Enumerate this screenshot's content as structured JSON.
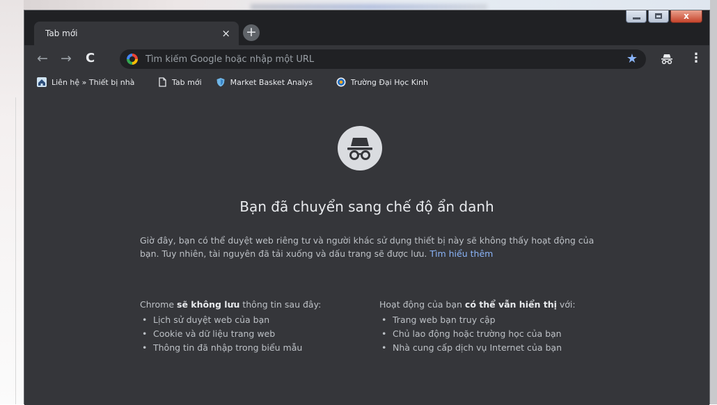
{
  "tab": {
    "title": "Tab mới",
    "close": "×",
    "new_tab": "+"
  },
  "window_controls": {
    "close": "x"
  },
  "toolbar": {
    "back": "←",
    "forward": "→",
    "reload": "C",
    "omnibox_placeholder": "Tìm kiếm Google hoặc nhập một URL",
    "star": "★",
    "menu": "⋮"
  },
  "bookmarks": [
    {
      "label": "Liên hệ » Thiết bị nhà",
      "icon": "home-icon"
    },
    {
      "label": "Tab mới",
      "icon": "page-icon"
    },
    {
      "label": "Market Basket Analys",
      "icon": "shield-icon"
    },
    {
      "label": "Trường Đại Học Kinh",
      "icon": "university-icon"
    }
  ],
  "content": {
    "headline": "Bạn đã chuyển sang chế độ ẩn danh",
    "description": "Giờ đây, bạn có thể duyệt web riêng tư và người khác sử dụng thiết bị này sẽ không thấy hoạt động của bạn. Tuy nhiên, tài nguyên đã tải xuống và dấu trang sẽ được lưu.",
    "learn_more": "Tìm hiểu thêm",
    "left_column": {
      "prefix": "Chrome ",
      "bold": "sẽ không lưu",
      "suffix": " thông tin sau đây:",
      "items": [
        "Lịch sử duyệt web của bạn",
        "Cookie và dữ liệu trang web",
        "Thông tin đã nhập trong biểu mẫu"
      ]
    },
    "right_column": {
      "prefix": "Hoạt động của bạn ",
      "bold": "có thể vẫn hiển thị",
      "suffix": " với:",
      "items": [
        "Trang web bạn truy cập",
        "Chủ lao động hoặc trường học của bạn",
        "Nhà cung cấp dịch vụ Internet của bạn"
      ]
    }
  },
  "colors": {
    "frame": "#202124",
    "surface": "#35363a",
    "text": "#e8eaed",
    "secondary_text": "#bdc1c6",
    "link": "#8ab4f8"
  }
}
